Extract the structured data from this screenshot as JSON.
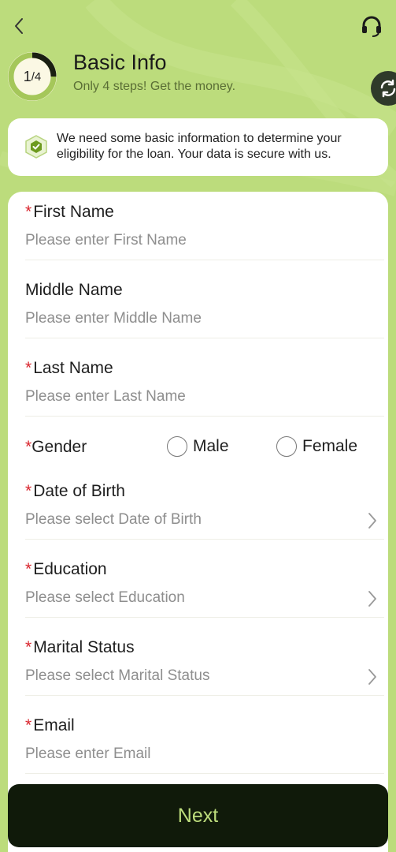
{
  "header": {
    "title": "Basic Info",
    "subtitle": "Only 4 steps! Get the money.",
    "step_current": "1",
    "step_sep": "/",
    "step_total": "4",
    "step_progress_fraction": 0.25
  },
  "notice": {
    "text": "We need some basic information to determine your eligibility for the loan. Your data is secure with us."
  },
  "form": {
    "first_name": {
      "required_mark": "*",
      "label": "First Name",
      "placeholder": "Please enter First Name"
    },
    "middle_name": {
      "label": "Middle Name",
      "placeholder": "Please enter Middle Name"
    },
    "last_name": {
      "required_mark": "*",
      "label": "Last Name",
      "placeholder": "Please enter Last Name"
    },
    "gender": {
      "required_mark": "*",
      "label": "Gender",
      "options": [
        "Male",
        "Female"
      ]
    },
    "dob": {
      "required_mark": "*",
      "label": "Date of Birth",
      "placeholder": "Please select Date of Birth"
    },
    "education": {
      "required_mark": "*",
      "label": "Education",
      "placeholder": "Please select Education"
    },
    "marital": {
      "required_mark": "*",
      "label": "Marital Status",
      "placeholder": "Please select Marital Status"
    },
    "email": {
      "required_mark": "*",
      "label": "Email",
      "placeholder": "Please enter Email"
    }
  },
  "actions": {
    "next_label": "Next"
  },
  "icons": {
    "back": "chevron-left-icon",
    "support": "headset-icon",
    "refresh": "refresh-icon",
    "shield": "shield-check-icon",
    "chevron": "chevron-right-icon"
  },
  "colors": {
    "background": "#bcdc7c",
    "accent": "#6d9a1f",
    "button_bg": "#101a0a",
    "button_text": "#bcdc7c",
    "required": "#d9262e"
  }
}
